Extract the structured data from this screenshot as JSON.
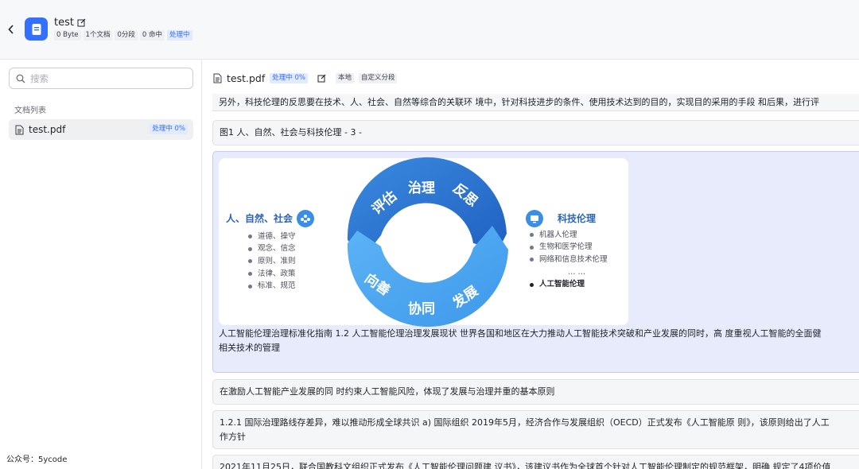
{
  "header": {
    "kb_name": "test",
    "tags": [
      "0 Byte",
      "1个文档",
      "0分段",
      "0 命中"
    ],
    "status": "处理中"
  },
  "sidebar": {
    "search_placeholder": "搜索",
    "section_label": "文档列表",
    "files": [
      {
        "name": "test.pdf",
        "status": "处理中 0%"
      }
    ],
    "footer_note": "公众号：5ycode"
  },
  "document": {
    "name": "test.pdf",
    "status": "处理中 0%",
    "tags": [
      "本地",
      "自定义分段"
    ],
    "chunks": [
      "另外，科技伦理的反思要在技术、人、社会、自然等综合的关联环 境中，针对科技进步的条件、使用技术达到的目的，实现目的采用的手段 和后果，进行评",
      "图1 人、自然、社会与科技伦理 - 3 -",
      "人工智能伦理治理标准化指南 1.2 人工智能伦理治理发展现状 世界各国和地区在大力推动人工智能技术突破和产业发展的同时，高 度重视人工智能的全面健",
      "相关技术的管理",
      "在激励人工智能产业发展的同 时约束人工智能风险，体现了发展与治理并重的基本原则",
      "1.2.1 国际治理路线存差异，难以推动形成全球共识 a) 国际组织 2019年5月，经济合作与发展组织（OECD）正式发布《人工智能原 则》，该原则给出了人工",
      "作方针",
      "2021年11月25日，联合国教科文组织正式发布《人工智能伦理问题建 议书》，该建议书作为全球首个针对人工智能伦理制定的规范框架，明确 规定了4项价值"
    ]
  },
  "figure": {
    "left_title": "人、自然、社会",
    "left_items": [
      "道德、操守",
      "观念、信念",
      "原则、准则",
      "法律、政策",
      "标准、规范"
    ],
    "right_title": "科技伦理",
    "right_items": [
      "机器人伦理",
      "生物和医学伦理",
      "网络和信息技术伦理",
      "… …"
    ],
    "right_highlight": "人工智能伦理",
    "ring_top": [
      "评估",
      "治理",
      "反思"
    ],
    "ring_bottom": [
      "向善",
      "协同",
      "发展"
    ],
    "colors": {
      "ring_dark": "#2a6fcf",
      "ring_light": "#49a8f2",
      "title_blue": "#2b64b8"
    }
  }
}
